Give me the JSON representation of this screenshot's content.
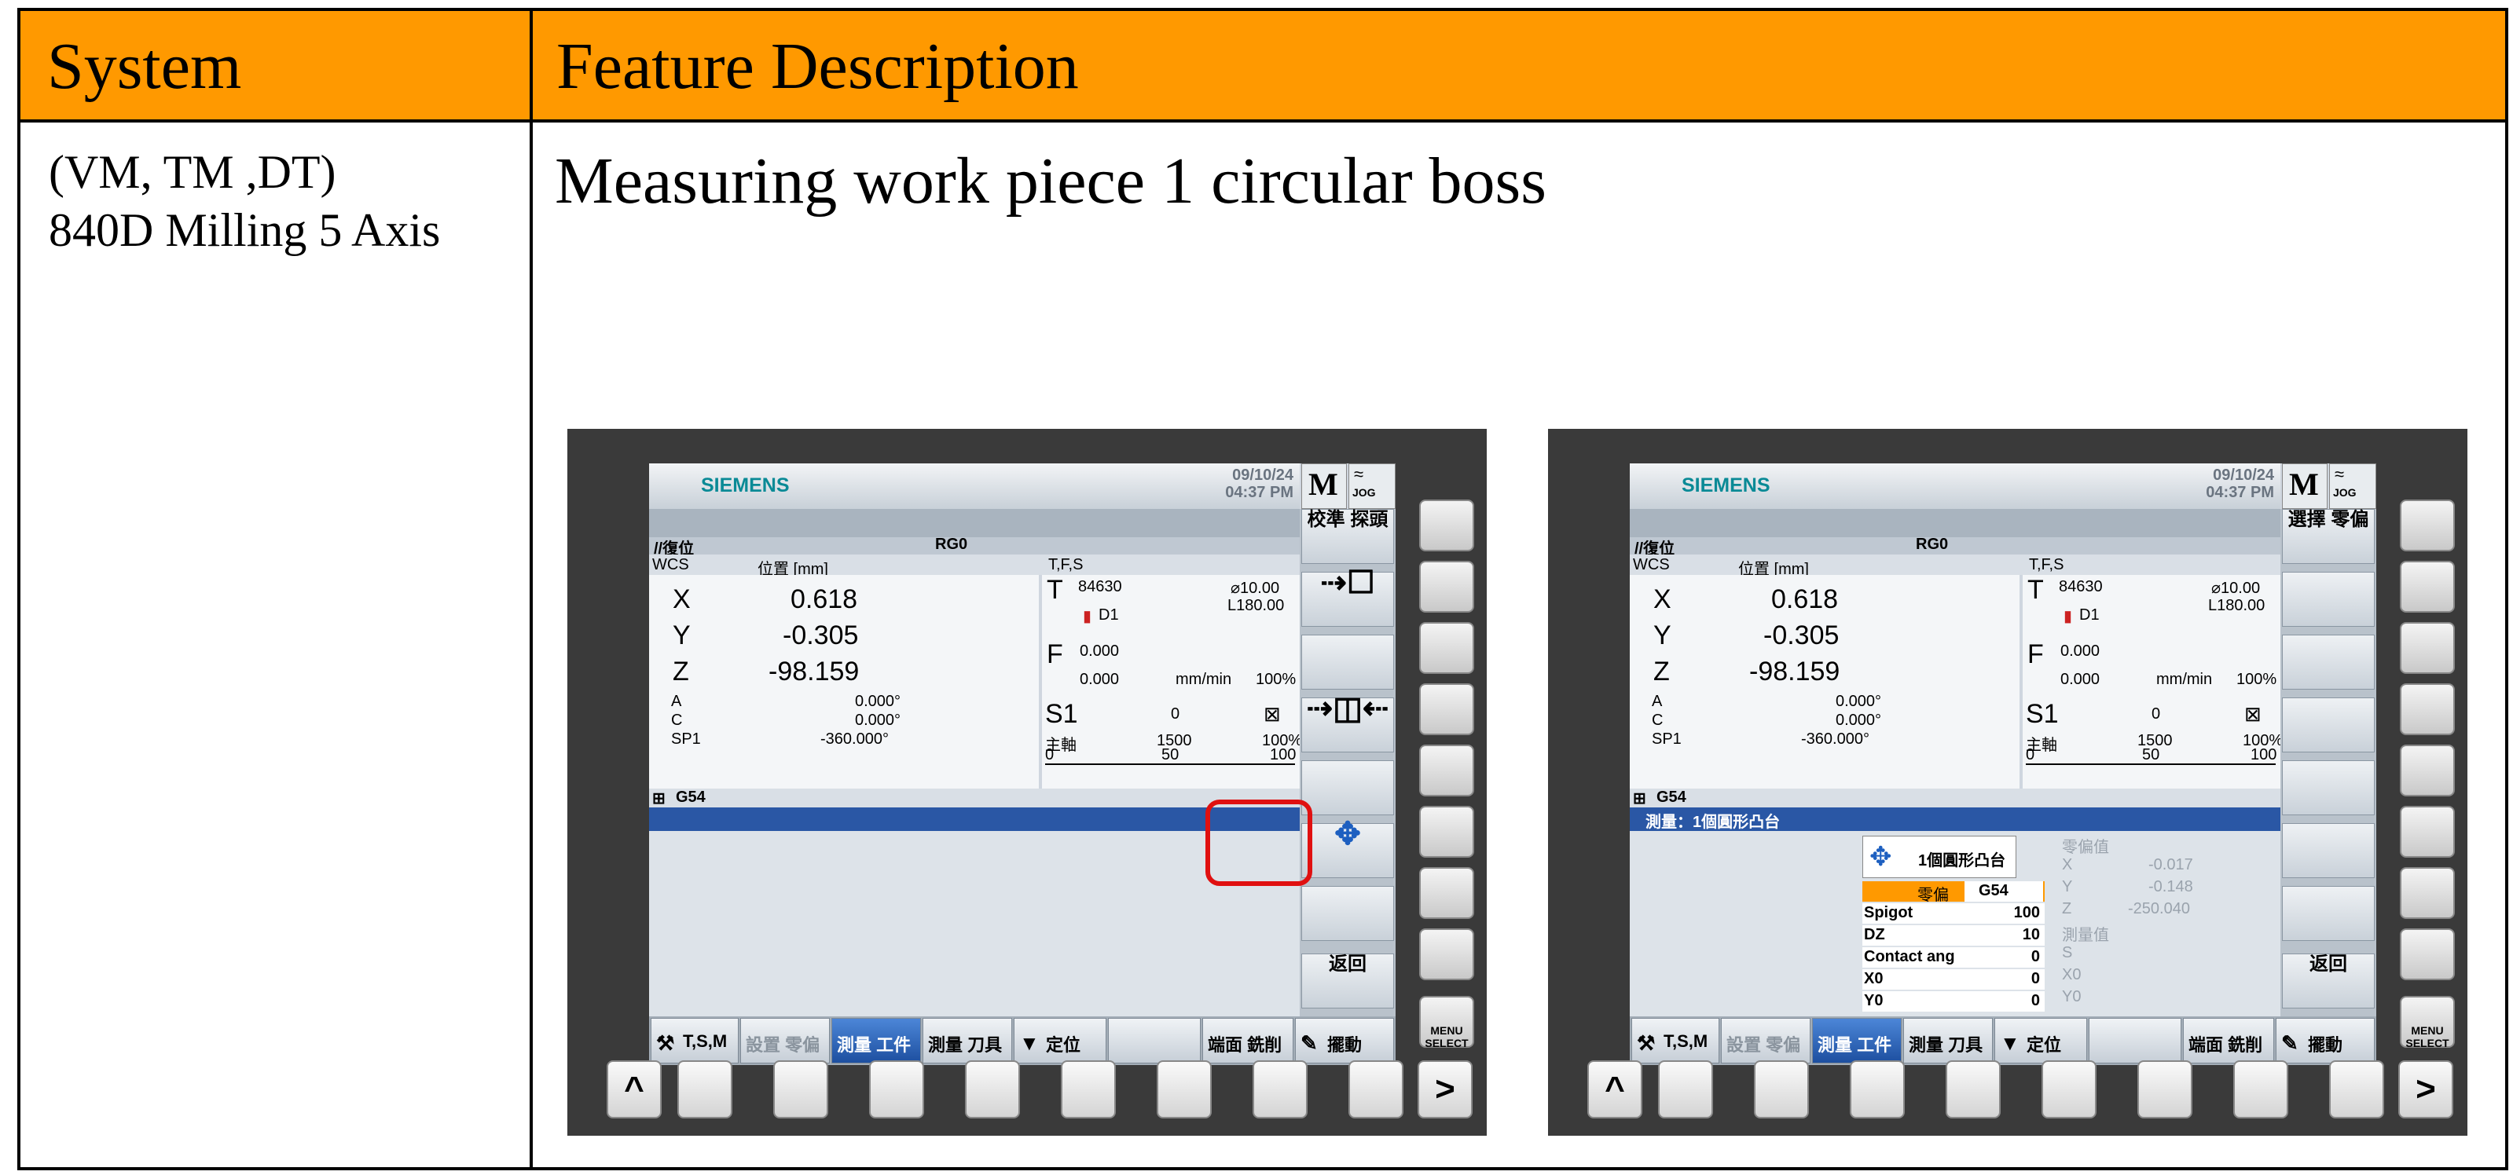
{
  "table": {
    "col_system": "System",
    "col_feature": "Feature Description",
    "system_line1": "(VM, TM ,DT)",
    "system_line2": "840D Milling 5 Axis",
    "feature_title": "Measuring work piece 1 circular boss"
  },
  "screen": {
    "brand": "SIEMENS",
    "date": "09/10/24",
    "time": "04:37 PM",
    "mode": "M",
    "jog": "JOG",
    "reset": "//復位",
    "program": "RG0",
    "wcs": "WCS",
    "pos_header": "位置 [mm]",
    "tfs_header": "T,F,S",
    "axes": [
      {
        "name": "X",
        "value": "0.618"
      },
      {
        "name": "Y",
        "value": "-0.305"
      },
      {
        "name": "Z",
        "value": "-98.159"
      },
      {
        "name": "A",
        "value": "0.000°"
      },
      {
        "name": "C",
        "value": "0.000°"
      },
      {
        "name": "SP1",
        "value": "-360.000°"
      }
    ],
    "tool": {
      "label": "T",
      "number": "84630",
      "diameter": "⌀10.00",
      "length": "L180.00",
      "d": "D1"
    },
    "feed": {
      "label": "F",
      "value1": "0.000",
      "value2": "0.000",
      "unit": "mm/min",
      "override": "100%"
    },
    "spindle": {
      "label": "S1",
      "value": "0",
      "name": "主軸",
      "speed": "1500",
      "override": "100%",
      "scale0": "0",
      "scale50": "50",
      "scale100": "100"
    },
    "g54": "G54",
    "back": "返回",
    "menu_select": "MENU SELECT",
    "hsoftkeys": [
      "T,S,M",
      "設置 零偏",
      "測量 工件",
      "測量 刀具",
      "定位",
      "端面 銑削",
      "擺動"
    ],
    "left_vsoft_top": "校準 探頭",
    "right_vsoft_top": "選擇 零偏",
    "measure_bar": "測量：1個圓形凸台",
    "measure_title": "1個圓形凸台",
    "fields": [
      {
        "k": "零偏",
        "v": "G54"
      },
      {
        "k": "Spigot",
        "v": "100"
      },
      {
        "k": "DZ",
        "v": "10"
      },
      {
        "k": "Contact ang",
        "v": "0"
      },
      {
        "k": "X0",
        "v": "0"
      },
      {
        "k": "Y0",
        "v": "0"
      }
    ],
    "offset_label": "零偏值",
    "offset_x": "-0.017",
    "offset_y": "-0.148",
    "offset_z": "-250.040",
    "meas_label": "測量值",
    "ax_x": "X",
    "ax_y": "Y",
    "ax_z": "Z",
    "ax_s": "S",
    "ax_x0": "X0",
    "ax_y0": "Y0",
    "key_up": "^",
    "key_right": ">"
  }
}
